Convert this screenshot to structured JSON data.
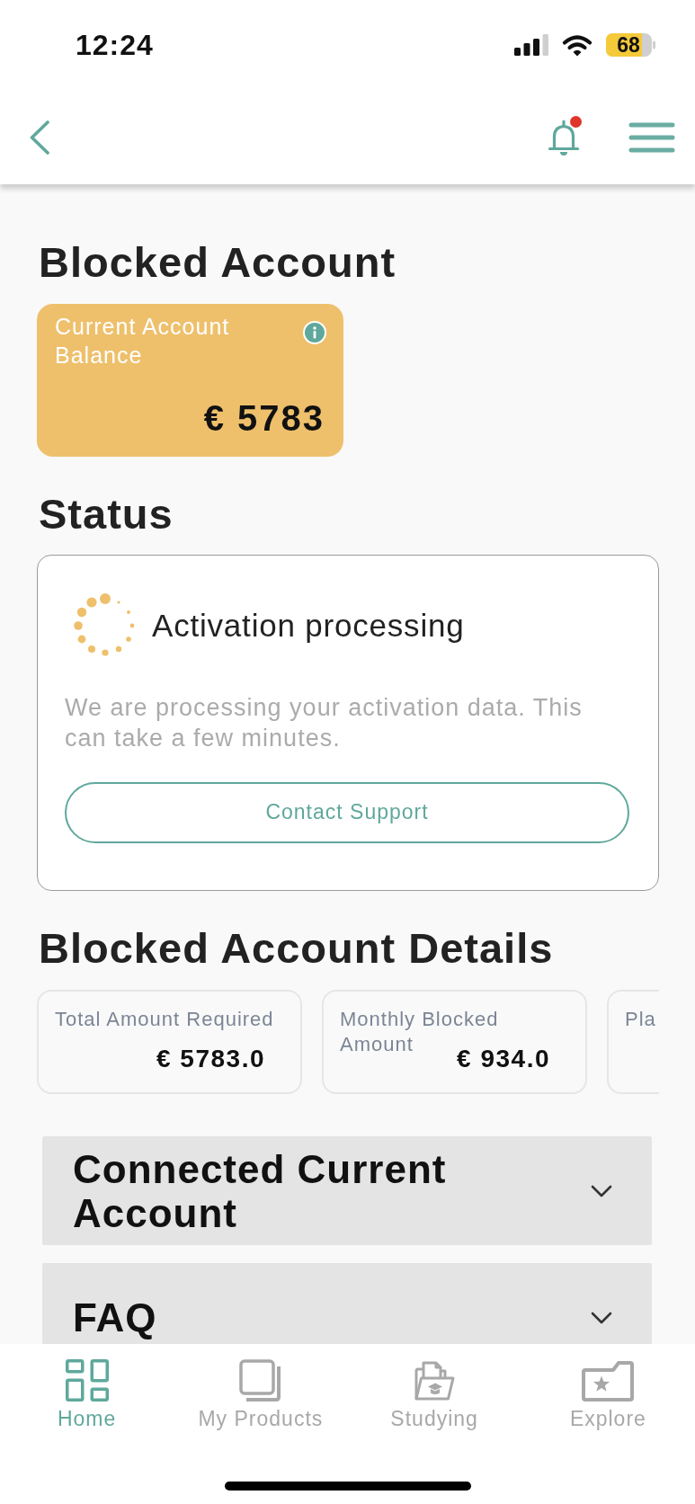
{
  "status_bar": {
    "time": "12:24",
    "battery": "68"
  },
  "header": {
    "unread": true
  },
  "page_title": "Blocked Account",
  "balance_card": {
    "label": "Current Account Balance",
    "amount": "€ 5783"
  },
  "status": {
    "heading": "Status",
    "title": "Activation processing",
    "description": "We are processing your activation data. This can take a few minutes.",
    "button": "Contact Support"
  },
  "details": {
    "heading": "Blocked Account Details",
    "cards": [
      {
        "label": "Total Amount Required",
        "value": "€ 5783.0"
      },
      {
        "label": "Monthly Blocked Amount",
        "value": "€ 934.0"
      },
      {
        "label": "Pla"
      }
    ]
  },
  "sections": [
    {
      "title": "Connected Current Account",
      "expanded": false
    },
    {
      "title": "FAQ",
      "expanded": false
    }
  ],
  "bottom_nav": [
    {
      "kind": "home",
      "label": "Home",
      "selected": true
    },
    {
      "kind": "products",
      "label": "My Products",
      "selected": false
    },
    {
      "kind": "studying",
      "label": "Studying",
      "selected": false
    },
    {
      "kind": "explore",
      "label": "Explore",
      "selected": false
    }
  ]
}
